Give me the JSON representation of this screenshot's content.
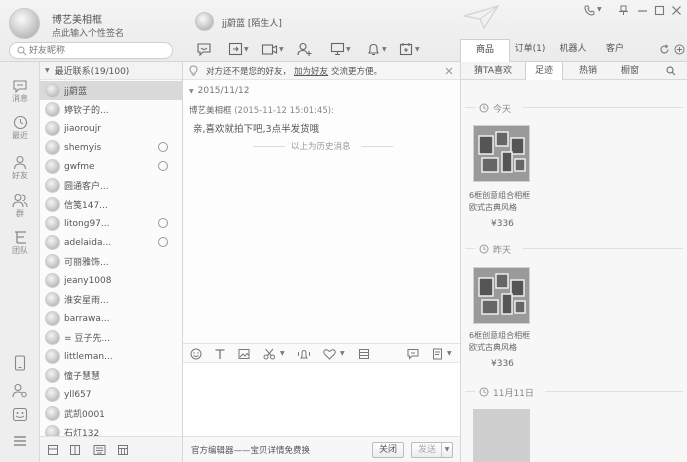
{
  "profile": {
    "name": "博艺美相框",
    "signature": "点此输入个性签名",
    "search_placeholder": "好友昵称"
  },
  "conversation": {
    "name": "jj蔚蓝",
    "tag": "[陌生人]"
  },
  "header_tabs": [
    {
      "label": "商品"
    },
    {
      "label": "订单(1)"
    },
    {
      "label": "机器人"
    },
    {
      "label": "客户"
    }
  ],
  "rail": [
    {
      "label": "消息",
      "icon": "chat-bubble-icon"
    },
    {
      "label": "最近",
      "icon": "clock-icon"
    },
    {
      "label": "好友",
      "icon": "person-icon"
    },
    {
      "label": "群",
      "icon": "group-icon"
    },
    {
      "label": "团队",
      "icon": "team-icon"
    }
  ],
  "contacts": {
    "header": "最近联系(19/100)",
    "items": [
      {
        "name": "jj蔚蓝",
        "status": false,
        "selected": true
      },
      {
        "name": "婷钦子的...",
        "status": false
      },
      {
        "name": "jiaoroujr",
        "status": false
      },
      {
        "name": "shemyis",
        "status": true
      },
      {
        "name": "gwfme",
        "status": true
      },
      {
        "name": "圆通客户...",
        "status": false
      },
      {
        "name": "信笺147...",
        "status": false
      },
      {
        "name": "litong97...",
        "status": true
      },
      {
        "name": "adelaida...",
        "status": true
      },
      {
        "name": "可丽雅饰...",
        "status": false
      },
      {
        "name": "jeany1008",
        "status": false
      },
      {
        "name": "淮安星雨...",
        "status": false
      },
      {
        "name": "barrawa...",
        "status": false
      },
      {
        "name": "= 豆子先...",
        "status": false
      },
      {
        "name": "littleman...",
        "status": false
      },
      {
        "name": "憧子慧慧",
        "status": false
      },
      {
        "name": "yll657",
        "status": false
      },
      {
        "name": "武凯0001",
        "status": false
      },
      {
        "name": "石灯132",
        "status": false
      }
    ]
  },
  "chat": {
    "notice": "对方还不是您的好友，",
    "notice_link": "加为好友",
    "notice_tail": "交流更方便。",
    "date": "2015/11/12",
    "sender": "博艺美相框",
    "time": "(2015-11-12 15:01:45):",
    "message": "亲,喜欢就拍下吧,3点半发货哦",
    "history_label": "以上为历史消息",
    "bottom_hint": "官方编辑器——宝贝详情免费换",
    "close_label": "关闭",
    "send_label": "发送"
  },
  "right": {
    "tabs": [
      {
        "label": "猜TA喜欢"
      },
      {
        "label": "足迹"
      },
      {
        "label": "热销"
      },
      {
        "label": "橱窗"
      }
    ],
    "groups": [
      {
        "title": "今天",
        "product": {
          "name": "6框创意组合相框 欧式古典风格",
          "price": "¥336"
        }
      },
      {
        "title": "昨天",
        "product": {
          "name": "6框创意组合相框 欧式古典风格",
          "price": "¥336"
        }
      },
      {
        "title": "11月11日"
      }
    ]
  },
  "colors": {
    "link": "#555555",
    "accent": "#888888"
  }
}
